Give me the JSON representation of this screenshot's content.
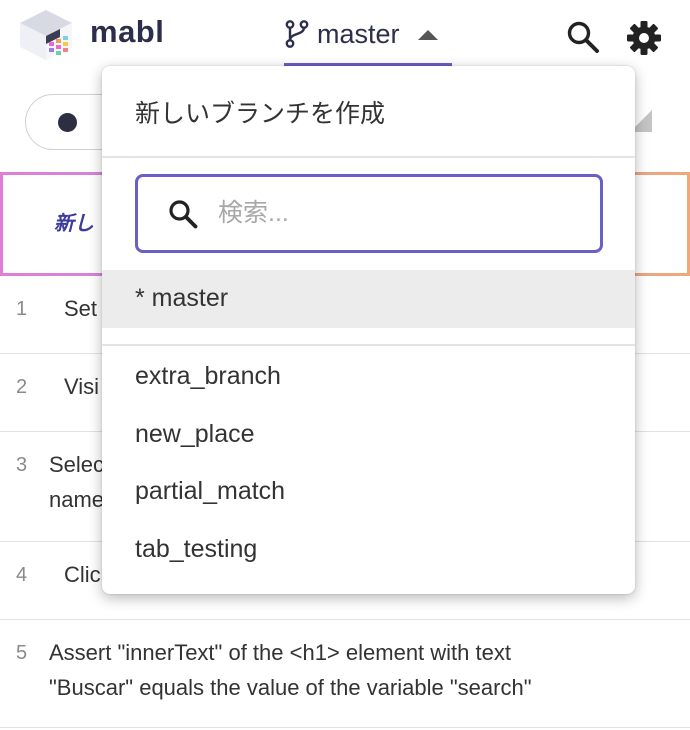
{
  "header": {
    "brand": "mabl",
    "branch_label": "master"
  },
  "background": {
    "new_step_label": "新し",
    "steps": [
      {
        "num": "1",
        "text": "Set"
      },
      {
        "num": "2",
        "text": "Visi"
      },
      {
        "num": "3",
        "text_line1": "Selec",
        "text_line2": "name"
      },
      {
        "num": "4",
        "text": "Clic"
      },
      {
        "num": "5",
        "text_line1": "Assert \"innerText\" of the <h1> element with text",
        "text_line2": "\"Buscar\" equals the value of the variable \"search\""
      }
    ]
  },
  "dropdown": {
    "create_label": "新しいブランチを作成",
    "search_placeholder": "検索...",
    "current_branch": "* master",
    "branches": [
      "extra_branch",
      "new_place",
      "partial_match",
      "tab_testing"
    ]
  },
  "colors": {
    "accent": "#6a5fc4",
    "brand_text": "#2d2f4a",
    "selected_row": "#ececec"
  }
}
